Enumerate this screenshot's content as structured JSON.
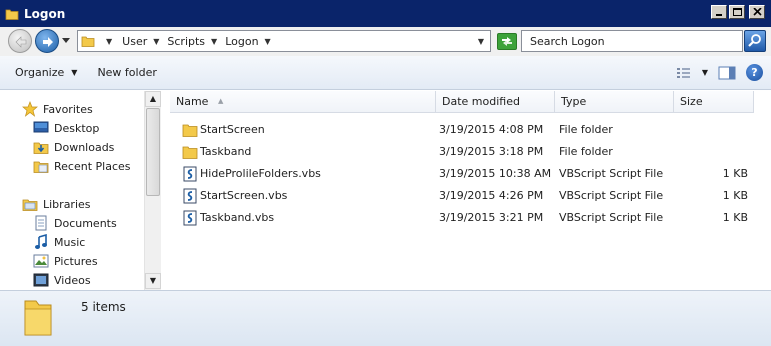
{
  "window": {
    "title": "Logon",
    "title_icon": "folder-icon",
    "controls": [
      "minimize",
      "maximize",
      "close"
    ]
  },
  "navigation": {
    "breadcrumb": [
      {
        "label": "User"
      },
      {
        "label": "Scripts"
      },
      {
        "label": "Logon"
      }
    ],
    "search_placeholder": "Search Logon"
  },
  "toolbar": {
    "organize_label": "Organize",
    "new_folder_label": "New folder"
  },
  "nav_pane": {
    "favorites_label": "Favorites",
    "favorites": [
      {
        "label": "Desktop",
        "icon": "desktop-icon"
      },
      {
        "label": "Downloads",
        "icon": "downloads-icon"
      },
      {
        "label": "Recent Places",
        "icon": "recent-places-icon"
      }
    ],
    "libraries_label": "Libraries",
    "libraries": [
      {
        "label": "Documents",
        "icon": "documents-icon"
      },
      {
        "label": "Music",
        "icon": "music-icon"
      },
      {
        "label": "Pictures",
        "icon": "pictures-icon"
      },
      {
        "label": "Videos",
        "icon": "videos-icon"
      }
    ]
  },
  "columns": {
    "name": "Name",
    "date": "Date modified",
    "type": "Type",
    "size": "Size"
  },
  "files": [
    {
      "name": "StartScreen",
      "date": "3/19/2015 4:08 PM",
      "type": "File folder",
      "size": "",
      "icon": "folder-icon"
    },
    {
      "name": "Taskband",
      "date": "3/19/2015 3:18 PM",
      "type": "File folder",
      "size": "",
      "icon": "folder-icon"
    },
    {
      "name": "HideProlileFolders.vbs",
      "date": "3/19/2015 10:38 AM",
      "type": "VBScript Script File",
      "size": "1 KB",
      "icon": "vbs-script-icon"
    },
    {
      "name": "StartScreen.vbs",
      "date": "3/19/2015 4:26 PM",
      "type": "VBScript Script File",
      "size": "1 KB",
      "icon": "vbs-script-icon"
    },
    {
      "name": "Taskband.vbs",
      "date": "3/19/2015 3:21 PM",
      "type": "VBScript Script File",
      "size": "1 KB",
      "icon": "vbs-script-icon"
    }
  ],
  "status": {
    "item_count": "5 items"
  }
}
